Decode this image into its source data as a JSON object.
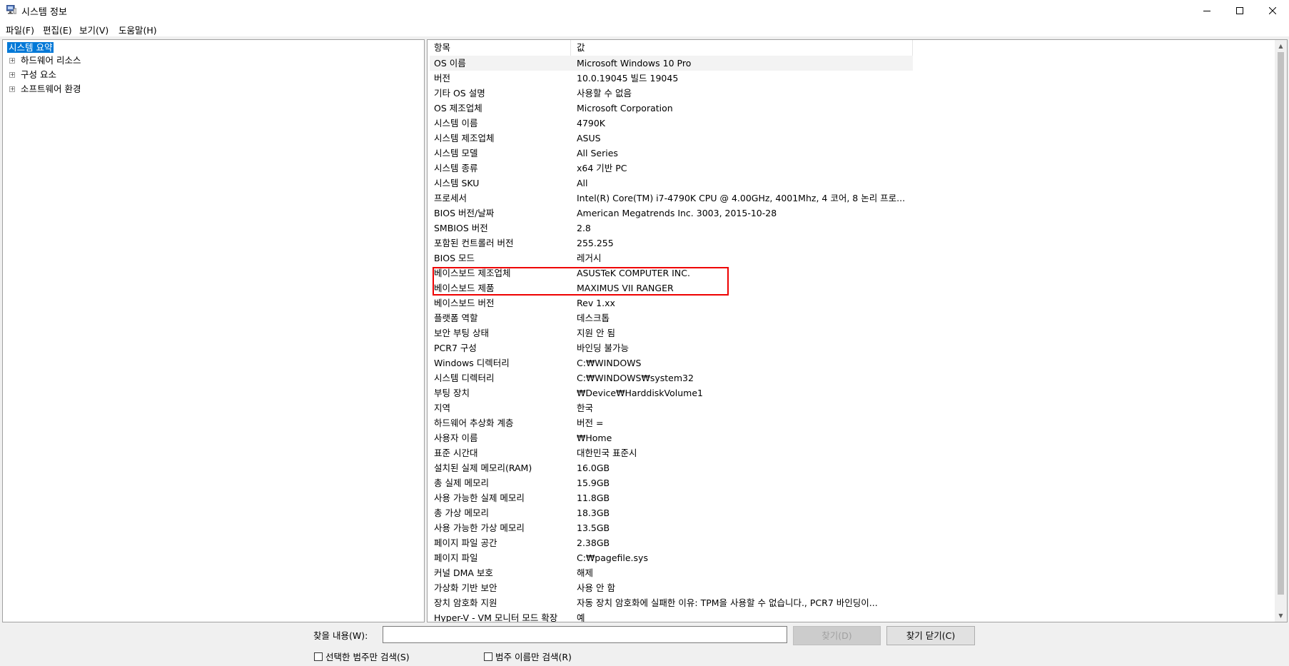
{
  "window": {
    "title": "시스템 정보"
  },
  "menu": [
    "파일(F)",
    "편집(E)",
    "보기(V)",
    "도움말(H)"
  ],
  "tree": {
    "selected": "시스템 요약",
    "children": [
      "하드웨어 리소스",
      "구성 요소",
      "소프트웨어 환경"
    ]
  },
  "table": {
    "headers": [
      "항목",
      "값"
    ],
    "rows": [
      [
        "OS 이름",
        "Microsoft Windows 10 Pro"
      ],
      [
        "버전",
        "10.0.19045 빌드 19045"
      ],
      [
        "기타 OS 설명",
        "사용할 수 없음"
      ],
      [
        "OS 제조업체",
        "Microsoft Corporation"
      ],
      [
        "시스템 이름",
        "4790K"
      ],
      [
        "시스템 제조업체",
        "ASUS"
      ],
      [
        "시스템 모델",
        "All Series"
      ],
      [
        "시스템 종류",
        "x64 기반 PC"
      ],
      [
        "시스템 SKU",
        "All"
      ],
      [
        "프로세서",
        "Intel(R) Core(TM) i7-4790K CPU @ 4.00GHz, 4001Mhz, 4 코어, 8 논리 프로..."
      ],
      [
        "BIOS 버전/날짜",
        "American Megatrends Inc. 3003, 2015-10-28"
      ],
      [
        "SMBIOS 버전",
        "2.8"
      ],
      [
        "포함된 컨트롤러 버전",
        "255.255"
      ],
      [
        "BIOS 모드",
        "레거시"
      ],
      [
        "베이스보드 제조업체",
        "ASUSTeK COMPUTER INC."
      ],
      [
        "베이스보드 제품",
        "MAXIMUS VII RANGER"
      ],
      [
        "베이스보드 버전",
        "Rev 1.xx"
      ],
      [
        "플랫폼 역할",
        "데스크톱"
      ],
      [
        "보안 부팅 상태",
        "지원 안 됨"
      ],
      [
        "PCR7 구성",
        "바인딩 불가능"
      ],
      [
        "Windows 디렉터리",
        "C:₩WINDOWS"
      ],
      [
        "시스템 디렉터리",
        "C:₩WINDOWS₩system32"
      ],
      [
        "부팅 장치",
        "₩Device₩HarddiskVolume1"
      ],
      [
        "지역",
        "한국"
      ],
      [
        "하드웨어 추상화 계층",
        "버전 ="
      ],
      [
        "사용자 이름",
        "         ₩Home"
      ],
      [
        "표준 시간대",
        "대한민국 표준시"
      ],
      [
        "설치된 실제 메모리(RAM)",
        "16.0GB"
      ],
      [
        "총 실제 메모리",
        "15.9GB"
      ],
      [
        "사용 가능한 실제 메모리",
        "11.8GB"
      ],
      [
        "총 가상 메모리",
        "18.3GB"
      ],
      [
        "사용 가능한 가상 메모리",
        "13.5GB"
      ],
      [
        "페이지 파일 공간",
        "2.38GB"
      ],
      [
        "페이지 파일",
        "C:₩pagefile.sys"
      ],
      [
        "커널 DMA 보호",
        "해제"
      ],
      [
        "가상화 기반 보안",
        "사용 안 함"
      ],
      [
        "장치 암호화 지원",
        "자동 장치 암호화에 실패한 이유: TPM을 사용할 수 없습니다., PCR7 바인딩이..."
      ],
      [
        "Hyper-V - VM 모니터 모드 확장",
        "예"
      ]
    ]
  },
  "find": {
    "label": "찾을 내용(W):",
    "value": "",
    "find_button": "찾기(D)",
    "close_button": "찾기 닫기(C)",
    "check_selected": "선택한 범주만 검색(S)",
    "check_names": "범주 이름만 검색(R)"
  }
}
